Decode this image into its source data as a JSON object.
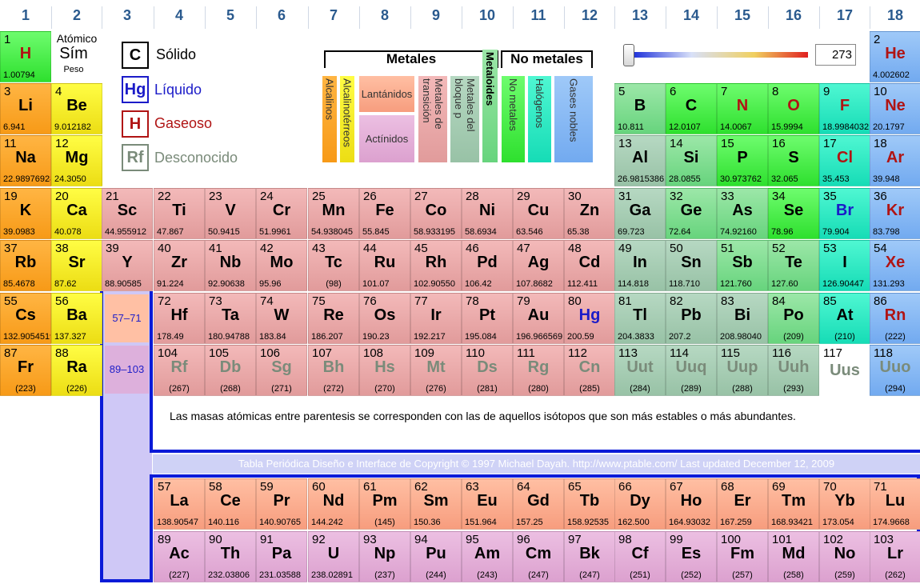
{
  "groups": [
    "1",
    "2",
    "3",
    "4",
    "5",
    "6",
    "7",
    "8",
    "9",
    "10",
    "11",
    "12",
    "13",
    "14",
    "15",
    "16",
    "17",
    "18"
  ],
  "key": {
    "atomic": "Atómico",
    "symbol": "Sím",
    "weight": "Peso"
  },
  "states": {
    "solid": {
      "box": "C",
      "label": "Sólido"
    },
    "liquid": {
      "box": "Hg",
      "label": "Líquido"
    },
    "gas": {
      "box": "H",
      "label": "Gaseoso"
    },
    "unknown": {
      "box": "Rf",
      "label": "Desconocido"
    }
  },
  "categories": {
    "metals_title": "Metales",
    "nonmetals_title": "No metales",
    "alkali": "Alcalinos",
    "alkaline": "Alcalinotérreos",
    "lanthanides": "Lantánidos",
    "actinides": "Actínidos",
    "transition": "Metales de transición",
    "post_transition": "Metales del bloque p",
    "metalloids": "Metaloides",
    "nonmetals": "No metales",
    "halogens": "Halógenos",
    "noble": "Gases nobles"
  },
  "temperature": {
    "value": "273",
    "fraction": 0.0
  },
  "refs": {
    "lanthanides": "57–71",
    "actinides": "89–103"
  },
  "note": "Las masas atómicas entre parentesis se corresponden con las de aquellos isótopos que son más estables o más abundantes.",
  "copyright": "Tabla Periódica Diseño e Interface de Copyright © 1997 Michael Dayah. http://www.ptable.com/ Last updated December 12, 2009",
  "elements": [
    {
      "n": "1",
      "s": "H",
      "m": "1.00794",
      "g": 1,
      "p": 1,
      "c": "nonmetal",
      "st": "gas"
    },
    {
      "n": "2",
      "s": "He",
      "m": "4.002602",
      "g": 18,
      "p": 1,
      "c": "noble",
      "st": "gas"
    },
    {
      "n": "3",
      "s": "Li",
      "m": "6.941",
      "g": 1,
      "p": 2,
      "c": "alkali",
      "st": "solid"
    },
    {
      "n": "4",
      "s": "Be",
      "m": "9.012182",
      "g": 2,
      "p": 2,
      "c": "alkaline",
      "st": "solid"
    },
    {
      "n": "5",
      "s": "B",
      "m": "10.811",
      "g": 13,
      "p": 2,
      "c": "metalloid",
      "st": "solid"
    },
    {
      "n": "6",
      "s": "C",
      "m": "12.0107",
      "g": 14,
      "p": 2,
      "c": "nonmetal",
      "st": "solid"
    },
    {
      "n": "7",
      "s": "N",
      "m": "14.0067",
      "g": 15,
      "p": 2,
      "c": "nonmetal",
      "st": "gas"
    },
    {
      "n": "8",
      "s": "O",
      "m": "15.9994",
      "g": 16,
      "p": 2,
      "c": "nonmetal",
      "st": "gas"
    },
    {
      "n": "9",
      "s": "F",
      "m": "18.9984032",
      "g": 17,
      "p": 2,
      "c": "halogen",
      "st": "gas"
    },
    {
      "n": "10",
      "s": "Ne",
      "m": "20.1797",
      "g": 18,
      "p": 2,
      "c": "noble",
      "st": "gas"
    },
    {
      "n": "11",
      "s": "Na",
      "m": "22.98976928",
      "g": 1,
      "p": 3,
      "c": "alkali",
      "st": "solid"
    },
    {
      "n": "12",
      "s": "Mg",
      "m": "24.3050",
      "g": 2,
      "p": 3,
      "c": "alkaline",
      "st": "solid"
    },
    {
      "n": "13",
      "s": "Al",
      "m": "26.9815386",
      "g": 13,
      "p": 3,
      "c": "post",
      "st": "solid"
    },
    {
      "n": "14",
      "s": "Si",
      "m": "28.0855",
      "g": 14,
      "p": 3,
      "c": "metalloid",
      "st": "solid"
    },
    {
      "n": "15",
      "s": "P",
      "m": "30.973762",
      "g": 15,
      "p": 3,
      "c": "nonmetal",
      "st": "solid"
    },
    {
      "n": "16",
      "s": "S",
      "m": "32.065",
      "g": 16,
      "p": 3,
      "c": "nonmetal",
      "st": "solid"
    },
    {
      "n": "17",
      "s": "Cl",
      "m": "35.453",
      "g": 17,
      "p": 3,
      "c": "halogen",
      "st": "gas"
    },
    {
      "n": "18",
      "s": "Ar",
      "m": "39.948",
      "g": 18,
      "p": 3,
      "c": "noble",
      "st": "gas"
    },
    {
      "n": "19",
      "s": "K",
      "m": "39.0983",
      "g": 1,
      "p": 4,
      "c": "alkali",
      "st": "solid"
    },
    {
      "n": "20",
      "s": "Ca",
      "m": "40.078",
      "g": 2,
      "p": 4,
      "c": "alkaline",
      "st": "solid"
    },
    {
      "n": "21",
      "s": "Sc",
      "m": "44.955912",
      "g": 3,
      "p": 4,
      "c": "transition",
      "st": "solid"
    },
    {
      "n": "22",
      "s": "Ti",
      "m": "47.867",
      "g": 4,
      "p": 4,
      "c": "transition",
      "st": "solid"
    },
    {
      "n": "23",
      "s": "V",
      "m": "50.9415",
      "g": 5,
      "p": 4,
      "c": "transition",
      "st": "solid"
    },
    {
      "n": "24",
      "s": "Cr",
      "m": "51.9961",
      "g": 6,
      "p": 4,
      "c": "transition",
      "st": "solid"
    },
    {
      "n": "25",
      "s": "Mn",
      "m": "54.938045",
      "g": 7,
      "p": 4,
      "c": "transition",
      "st": "solid"
    },
    {
      "n": "26",
      "s": "Fe",
      "m": "55.845",
      "g": 8,
      "p": 4,
      "c": "transition",
      "st": "solid"
    },
    {
      "n": "27",
      "s": "Co",
      "m": "58.933195",
      "g": 9,
      "p": 4,
      "c": "transition",
      "st": "solid"
    },
    {
      "n": "28",
      "s": "Ni",
      "m": "58.6934",
      "g": 10,
      "p": 4,
      "c": "transition",
      "st": "solid"
    },
    {
      "n": "29",
      "s": "Cu",
      "m": "63.546",
      "g": 11,
      "p": 4,
      "c": "transition",
      "st": "solid"
    },
    {
      "n": "30",
      "s": "Zn",
      "m": "65.38",
      "g": 12,
      "p": 4,
      "c": "transition",
      "st": "solid"
    },
    {
      "n": "31",
      "s": "Ga",
      "m": "69.723",
      "g": 13,
      "p": 4,
      "c": "post",
      "st": "solid"
    },
    {
      "n": "32",
      "s": "Ge",
      "m": "72.64",
      "g": 14,
      "p": 4,
      "c": "metalloid",
      "st": "solid"
    },
    {
      "n": "33",
      "s": "As",
      "m": "74.92160",
      "g": 15,
      "p": 4,
      "c": "metalloid",
      "st": "solid"
    },
    {
      "n": "34",
      "s": "Se",
      "m": "78.96",
      "g": 16,
      "p": 4,
      "c": "nonmetal",
      "st": "solid"
    },
    {
      "n": "35",
      "s": "Br",
      "m": "79.904",
      "g": 17,
      "p": 4,
      "c": "halogen",
      "st": "liquid"
    },
    {
      "n": "36",
      "s": "Kr",
      "m": "83.798",
      "g": 18,
      "p": 4,
      "c": "noble",
      "st": "gas"
    },
    {
      "n": "37",
      "s": "Rb",
      "m": "85.4678",
      "g": 1,
      "p": 5,
      "c": "alkali",
      "st": "solid"
    },
    {
      "n": "38",
      "s": "Sr",
      "m": "87.62",
      "g": 2,
      "p": 5,
      "c": "alkaline",
      "st": "solid"
    },
    {
      "n": "39",
      "s": "Y",
      "m": "88.90585",
      "g": 3,
      "p": 5,
      "c": "transition",
      "st": "solid"
    },
    {
      "n": "40",
      "s": "Zr",
      "m": "91.224",
      "g": 4,
      "p": 5,
      "c": "transition",
      "st": "solid"
    },
    {
      "n": "41",
      "s": "Nb",
      "m": "92.90638",
      "g": 5,
      "p": 5,
      "c": "transition",
      "st": "solid"
    },
    {
      "n": "42",
      "s": "Mo",
      "m": "95.96",
      "g": 6,
      "p": 5,
      "c": "transition",
      "st": "solid"
    },
    {
      "n": "43",
      "s": "Tc",
      "m": "(98)",
      "g": 7,
      "p": 5,
      "c": "transition",
      "st": "solid"
    },
    {
      "n": "44",
      "s": "Ru",
      "m": "101.07",
      "g": 8,
      "p": 5,
      "c": "transition",
      "st": "solid"
    },
    {
      "n": "45",
      "s": "Rh",
      "m": "102.90550",
      "g": 9,
      "p": 5,
      "c": "transition",
      "st": "solid"
    },
    {
      "n": "46",
      "s": "Pd",
      "m": "106.42",
      "g": 10,
      "p": 5,
      "c": "transition",
      "st": "solid"
    },
    {
      "n": "47",
      "s": "Ag",
      "m": "107.8682",
      "g": 11,
      "p": 5,
      "c": "transition",
      "st": "solid"
    },
    {
      "n": "48",
      "s": "Cd",
      "m": "112.411",
      "g": 12,
      "p": 5,
      "c": "transition",
      "st": "solid"
    },
    {
      "n": "49",
      "s": "In",
      "m": "114.818",
      "g": 13,
      "p": 5,
      "c": "post",
      "st": "solid"
    },
    {
      "n": "50",
      "s": "Sn",
      "m": "118.710",
      "g": 14,
      "p": 5,
      "c": "post",
      "st": "solid"
    },
    {
      "n": "51",
      "s": "Sb",
      "m": "121.760",
      "g": 15,
      "p": 5,
      "c": "metalloid",
      "st": "solid"
    },
    {
      "n": "52",
      "s": "Te",
      "m": "127.60",
      "g": 16,
      "p": 5,
      "c": "metalloid",
      "st": "solid"
    },
    {
      "n": "53",
      "s": "I",
      "m": "126.90447",
      "g": 17,
      "p": 5,
      "c": "halogen",
      "st": "solid"
    },
    {
      "n": "54",
      "s": "Xe",
      "m": "131.293",
      "g": 18,
      "p": 5,
      "c": "noble",
      "st": "gas"
    },
    {
      "n": "55",
      "s": "Cs",
      "m": "132.9054519",
      "g": 1,
      "p": 6,
      "c": "alkali",
      "st": "solid"
    },
    {
      "n": "56",
      "s": "Ba",
      "m": "137.327",
      "g": 2,
      "p": 6,
      "c": "alkaline",
      "st": "solid"
    },
    {
      "n": "72",
      "s": "Hf",
      "m": "178.49",
      "g": 4,
      "p": 6,
      "c": "transition",
      "st": "solid"
    },
    {
      "n": "73",
      "s": "Ta",
      "m": "180.94788",
      "g": 5,
      "p": 6,
      "c": "transition",
      "st": "solid"
    },
    {
      "n": "74",
      "s": "W",
      "m": "183.84",
      "g": 6,
      "p": 6,
      "c": "transition",
      "st": "solid"
    },
    {
      "n": "75",
      "s": "Re",
      "m": "186.207",
      "g": 7,
      "p": 6,
      "c": "transition",
      "st": "solid"
    },
    {
      "n": "76",
      "s": "Os",
      "m": "190.23",
      "g": 8,
      "p": 6,
      "c": "transition",
      "st": "solid"
    },
    {
      "n": "77",
      "s": "Ir",
      "m": "192.217",
      "g": 9,
      "p": 6,
      "c": "transition",
      "st": "solid"
    },
    {
      "n": "78",
      "s": "Pt",
      "m": "195.084",
      "g": 10,
      "p": 6,
      "c": "transition",
      "st": "solid"
    },
    {
      "n": "79",
      "s": "Au",
      "m": "196.966569",
      "g": 11,
      "p": 6,
      "c": "transition",
      "st": "solid"
    },
    {
      "n": "80",
      "s": "Hg",
      "m": "200.59",
      "g": 12,
      "p": 6,
      "c": "transition",
      "st": "liquid"
    },
    {
      "n": "81",
      "s": "Tl",
      "m": "204.3833",
      "g": 13,
      "p": 6,
      "c": "post",
      "st": "solid"
    },
    {
      "n": "82",
      "s": "Pb",
      "m": "207.2",
      "g": 14,
      "p": 6,
      "c": "post",
      "st": "solid"
    },
    {
      "n": "83",
      "s": "Bi",
      "m": "208.98040",
      "g": 15,
      "p": 6,
      "c": "post",
      "st": "solid"
    },
    {
      "n": "84",
      "s": "Po",
      "m": "(209)",
      "g": 16,
      "p": 6,
      "c": "metalloid",
      "st": "solid"
    },
    {
      "n": "85",
      "s": "At",
      "m": "(210)",
      "g": 17,
      "p": 6,
      "c": "halogen",
      "st": "solid"
    },
    {
      "n": "86",
      "s": "Rn",
      "m": "(222)",
      "g": 18,
      "p": 6,
      "c": "noble",
      "st": "gas"
    },
    {
      "n": "87",
      "s": "Fr",
      "m": "(223)",
      "g": 1,
      "p": 7,
      "c": "alkali",
      "st": "solid"
    },
    {
      "n": "88",
      "s": "Ra",
      "m": "(226)",
      "g": 2,
      "p": 7,
      "c": "alkaline",
      "st": "solid"
    },
    {
      "n": "104",
      "s": "Rf",
      "m": "(267)",
      "g": 4,
      "p": 7,
      "c": "transition",
      "st": "unknown"
    },
    {
      "n": "105",
      "s": "Db",
      "m": "(268)",
      "g": 5,
      "p": 7,
      "c": "transition",
      "st": "unknown"
    },
    {
      "n": "106",
      "s": "Sg",
      "m": "(271)",
      "g": 6,
      "p": 7,
      "c": "transition",
      "st": "unknown"
    },
    {
      "n": "107",
      "s": "Bh",
      "m": "(272)",
      "g": 7,
      "p": 7,
      "c": "transition",
      "st": "unknown"
    },
    {
      "n": "108",
      "s": "Hs",
      "m": "(270)",
      "g": 8,
      "p": 7,
      "c": "transition",
      "st": "unknown"
    },
    {
      "n": "109",
      "s": "Mt",
      "m": "(276)",
      "g": 9,
      "p": 7,
      "c": "transition",
      "st": "unknown"
    },
    {
      "n": "110",
      "s": "Ds",
      "m": "(281)",
      "g": 10,
      "p": 7,
      "c": "transition",
      "st": "unknown"
    },
    {
      "n": "111",
      "s": "Rg",
      "m": "(280)",
      "g": 11,
      "p": 7,
      "c": "transition",
      "st": "unknown"
    },
    {
      "n": "112",
      "s": "Cn",
      "m": "(285)",
      "g": 12,
      "p": 7,
      "c": "transition",
      "st": "unknown"
    },
    {
      "n": "113",
      "s": "Uut",
      "m": "(284)",
      "g": 13,
      "p": 7,
      "c": "post",
      "st": "unknown"
    },
    {
      "n": "114",
      "s": "Uuq",
      "m": "(289)",
      "g": 14,
      "p": 7,
      "c": "post",
      "st": "unknown"
    },
    {
      "n": "115",
      "s": "Uup",
      "m": "(288)",
      "g": 15,
      "p": 7,
      "c": "post",
      "st": "unknown"
    },
    {
      "n": "116",
      "s": "Uuh",
      "m": "(293)",
      "g": 16,
      "p": 7,
      "c": "post",
      "st": "unknown"
    },
    {
      "n": "117",
      "s": "Uus",
      "m": "",
      "g": 17,
      "p": 7,
      "c": "uus",
      "st": "unknown"
    },
    {
      "n": "118",
      "s": "Uuo",
      "m": "(294)",
      "g": 18,
      "p": 7,
      "c": "noble",
      "st": "unknown"
    },
    {
      "n": "57",
      "s": "La",
      "m": "138.90547",
      "g": 4,
      "p": 9,
      "c": "lanth",
      "st": "solid"
    },
    {
      "n": "58",
      "s": "Ce",
      "m": "140.116",
      "g": 5,
      "p": 9,
      "c": "lanth",
      "st": "solid"
    },
    {
      "n": "59",
      "s": "Pr",
      "m": "140.90765",
      "g": 6,
      "p": 9,
      "c": "lanth",
      "st": "solid"
    },
    {
      "n": "60",
      "s": "Nd",
      "m": "144.242",
      "g": 7,
      "p": 9,
      "c": "lanth",
      "st": "solid"
    },
    {
      "n": "61",
      "s": "Pm",
      "m": "(145)",
      "g": 8,
      "p": 9,
      "c": "lanth",
      "st": "solid"
    },
    {
      "n": "62",
      "s": "Sm",
      "m": "150.36",
      "g": 9,
      "p": 9,
      "c": "lanth",
      "st": "solid"
    },
    {
      "n": "63",
      "s": "Eu",
      "m": "151.964",
      "g": 10,
      "p": 9,
      "c": "lanth",
      "st": "solid"
    },
    {
      "n": "64",
      "s": "Gd",
      "m": "157.25",
      "g": 11,
      "p": 9,
      "c": "lanth",
      "st": "solid"
    },
    {
      "n": "65",
      "s": "Tb",
      "m": "158.92535",
      "g": 12,
      "p": 9,
      "c": "lanth",
      "st": "solid"
    },
    {
      "n": "66",
      "s": "Dy",
      "m": "162.500",
      "g": 13,
      "p": 9,
      "c": "lanth",
      "st": "solid"
    },
    {
      "n": "67",
      "s": "Ho",
      "m": "164.93032",
      "g": 14,
      "p": 9,
      "c": "lanth",
      "st": "solid"
    },
    {
      "n": "68",
      "s": "Er",
      "m": "167.259",
      "g": 15,
      "p": 9,
      "c": "lanth",
      "st": "solid"
    },
    {
      "n": "69",
      "s": "Tm",
      "m": "168.93421",
      "g": 16,
      "p": 9,
      "c": "lanth",
      "st": "solid"
    },
    {
      "n": "70",
      "s": "Yb",
      "m": "173.054",
      "g": 17,
      "p": 9,
      "c": "lanth",
      "st": "solid"
    },
    {
      "n": "71",
      "s": "Lu",
      "m": "174.9668",
      "g": 18,
      "p": 9,
      "c": "lanth",
      "st": "solid"
    },
    {
      "n": "89",
      "s": "Ac",
      "m": "(227)",
      "g": 4,
      "p": 10,
      "c": "actin",
      "st": "solid"
    },
    {
      "n": "90",
      "s": "Th",
      "m": "232.03806",
      "g": 5,
      "p": 10,
      "c": "actin",
      "st": "solid"
    },
    {
      "n": "91",
      "s": "Pa",
      "m": "231.03588",
      "g": 6,
      "p": 10,
      "c": "actin",
      "st": "solid"
    },
    {
      "n": "92",
      "s": "U",
      "m": "238.02891",
      "g": 7,
      "p": 10,
      "c": "actin",
      "st": "solid"
    },
    {
      "n": "93",
      "s": "Np",
      "m": "(237)",
      "g": 8,
      "p": 10,
      "c": "actin",
      "st": "solid"
    },
    {
      "n": "94",
      "s": "Pu",
      "m": "(244)",
      "g": 9,
      "p": 10,
      "c": "actin",
      "st": "solid"
    },
    {
      "n": "95",
      "s": "Am",
      "m": "(243)",
      "g": 10,
      "p": 10,
      "c": "actin",
      "st": "solid"
    },
    {
      "n": "96",
      "s": "Cm",
      "m": "(247)",
      "g": 11,
      "p": 10,
      "c": "actin",
      "st": "solid"
    },
    {
      "n": "97",
      "s": "Bk",
      "m": "(247)",
      "g": 12,
      "p": 10,
      "c": "actin",
      "st": "solid"
    },
    {
      "n": "98",
      "s": "Cf",
      "m": "(251)",
      "g": 13,
      "p": 10,
      "c": "actin",
      "st": "solid"
    },
    {
      "n": "99",
      "s": "Es",
      "m": "(252)",
      "g": 14,
      "p": 10,
      "c": "actin",
      "st": "solid"
    },
    {
      "n": "100",
      "s": "Fm",
      "m": "(257)",
      "g": 15,
      "p": 10,
      "c": "actin",
      "st": "solid"
    },
    {
      "n": "101",
      "s": "Md",
      "m": "(258)",
      "g": 16,
      "p": 10,
      "c": "actin",
      "st": "solid"
    },
    {
      "n": "102",
      "s": "No",
      "m": "(259)",
      "g": 17,
      "p": 10,
      "c": "actin",
      "st": "solid"
    },
    {
      "n": "103",
      "s": "Lr",
      "m": "(262)",
      "g": 18,
      "p": 10,
      "c": "actin",
      "st": "solid"
    }
  ]
}
